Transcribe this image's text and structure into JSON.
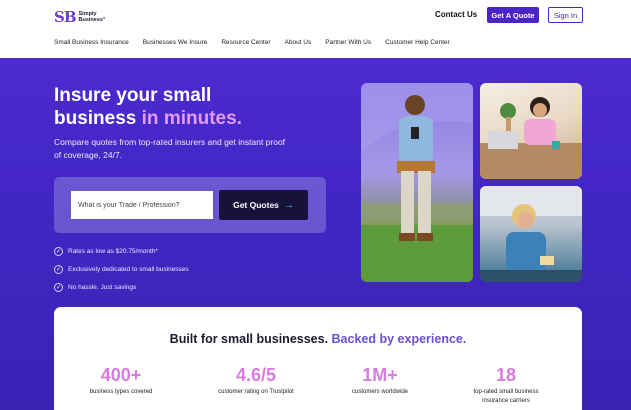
{
  "header": {
    "logo_mark": "SB",
    "logo_line1": "Simply",
    "logo_line2": "Business°",
    "contact_label": "Contact Us",
    "get_quote_label": "Get A Quote",
    "sign_in_label": "Sign In"
  },
  "nav": {
    "items": [
      "Small Business Insurance",
      "Businesses We Insure",
      "Resource Center",
      "About Us",
      "Partner With Us",
      "Customer Help Center"
    ]
  },
  "hero": {
    "title_line1": "Insure your small",
    "title_line2_plain": "business ",
    "title_line2_accent": "in minutes.",
    "subtitle": "Compare quotes from top-rated insurers and get instant proof of coverage, 24/7.",
    "search_placeholder": "What is your Trade / Profession?",
    "search_value": "",
    "cta_label": "Get Quotes",
    "cta_arrow": "→",
    "bullets": [
      "Rates as low as $20.75/month*",
      "Exclusively dedicated to small businesses",
      "No hassle. Just savings"
    ]
  },
  "photos": [
    {
      "subject": "contractor in tool belt looking at phone"
    },
    {
      "subject": "woman smiling at laptop with plants"
    },
    {
      "subject": "woman holding card at counter"
    }
  ],
  "stats": {
    "title_plain": "Built for small businesses. ",
    "title_accent": "Backed by experience.",
    "items": [
      {
        "value": "400+",
        "label": "business types covered"
      },
      {
        "value": "4.6/5",
        "label": "customer rating on Trustpilot"
      },
      {
        "value": "1M+",
        "label": "customers worldwide"
      },
      {
        "value": "18",
        "label": "top-rated small business insurance carriers"
      }
    ]
  },
  "colors": {
    "brand": "#4a23c9",
    "accent_pink": "#d77be0",
    "hero_bg": "#4226c4",
    "cta_dark": "#16123a"
  }
}
